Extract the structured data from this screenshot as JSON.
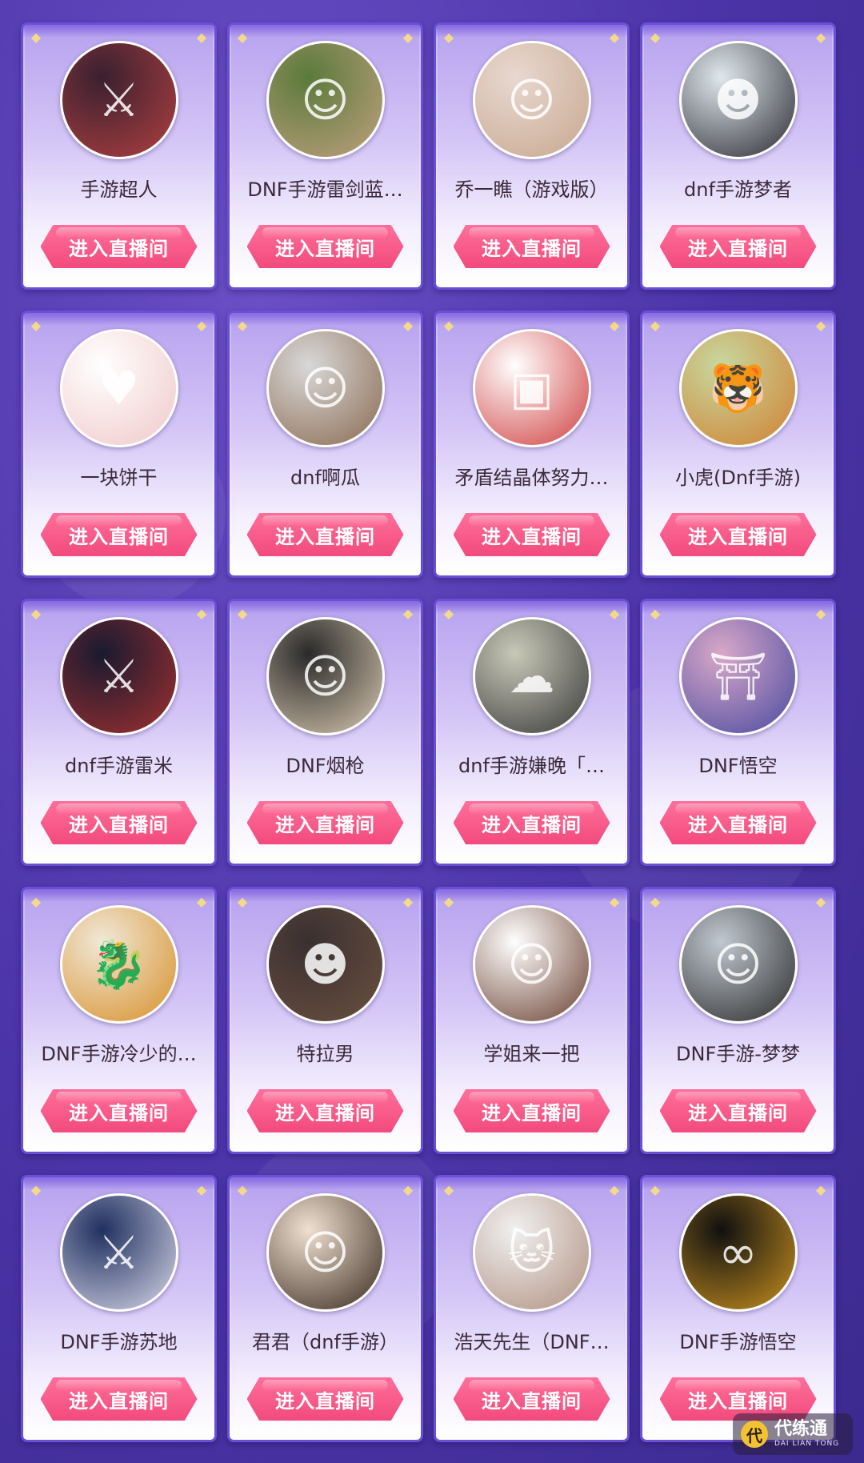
{
  "button_label": "进入直播间",
  "streamers": [
    {
      "name": "手游超人",
      "avatar_icon": "game-character-icon",
      "avatar_colors": [
        "#3a2030",
        "#b04040"
      ],
      "glyph": "⚔"
    },
    {
      "name": "DNF手游雷剑蓝…",
      "avatar_icon": "man-photo-icon",
      "avatar_colors": [
        "#5a7a3a",
        "#c0a080"
      ],
      "glyph": "☺"
    },
    {
      "name": "乔一瞧（游戏版）",
      "avatar_icon": "woman-photo-icon",
      "avatar_colors": [
        "#e8d8d0",
        "#c8a890"
      ],
      "glyph": "☺"
    },
    {
      "name": "dnf手游梦者",
      "avatar_icon": "anime-boy-icon",
      "avatar_colors": [
        "#dfe8ee",
        "#2a2a30"
      ],
      "glyph": "☻"
    },
    {
      "name": "一块饼干",
      "avatar_icon": "cartoon-girl-icon",
      "avatar_colors": [
        "#ffffff",
        "#f0c8c8"
      ],
      "glyph": "♥"
    },
    {
      "name": "dnf啊瓜",
      "avatar_icon": "man-selfie-icon",
      "avatar_colors": [
        "#d8d8d8",
        "#8a6a50"
      ],
      "glyph": "☺"
    },
    {
      "name": "矛盾结晶体努力…",
      "avatar_icon": "pixel-character-icon",
      "avatar_colors": [
        "#ffffff",
        "#d04040"
      ],
      "glyph": "▣"
    },
    {
      "name": "小虎(Dnf手游)",
      "avatar_icon": "tiger-icon",
      "avatar_colors": [
        "#c8d8a0",
        "#d08030"
      ],
      "glyph": "🐯"
    },
    {
      "name": "dnf手游雷米",
      "avatar_icon": "game-character-icon",
      "avatar_colors": [
        "#1a1a30",
        "#a03030"
      ],
      "glyph": "⚔"
    },
    {
      "name": "DNF烟枪",
      "avatar_icon": "man-photo-icon",
      "avatar_colors": [
        "#2a2a2a",
        "#d8c8b0"
      ],
      "glyph": "☺"
    },
    {
      "name": "dnf手游嫌晚「…",
      "avatar_icon": "car-window-icon",
      "avatar_colors": [
        "#c8c8b8",
        "#3a3a3a"
      ],
      "glyph": "☁"
    },
    {
      "name": "DNF悟空",
      "avatar_icon": "game-scene-icon",
      "avatar_colors": [
        "#d8a8c8",
        "#4a4aa0"
      ],
      "glyph": "⛩"
    },
    {
      "name": "DNF手游冷少的…",
      "avatar_icon": "golden-dragon-icon",
      "avatar_colors": [
        "#f0e8d8",
        "#d8902a"
      ],
      "glyph": "🐉"
    },
    {
      "name": "特拉男",
      "avatar_icon": "anime-man-icon",
      "avatar_colors": [
        "#3a3030",
        "#6a5040"
      ],
      "glyph": "☻"
    },
    {
      "name": "学姐来一把",
      "avatar_icon": "anime-girl-icon",
      "avatar_colors": [
        "#ffffff",
        "#6a4030"
      ],
      "glyph": "☺"
    },
    {
      "name": "DNF手游-梦梦",
      "avatar_icon": "woman-photo-icon",
      "avatar_colors": [
        "#c0c8d0",
        "#2a2a2a"
      ],
      "glyph": "☺"
    },
    {
      "name": "DNF手游苏地",
      "avatar_icon": "game-character-icon",
      "avatar_colors": [
        "#203060",
        "#d8d8e8"
      ],
      "glyph": "⚔"
    },
    {
      "name": "君君（dnf手游）",
      "avatar_icon": "anime-girl-icon",
      "avatar_colors": [
        "#f0e0d0",
        "#3a2a20"
      ],
      "glyph": "☺"
    },
    {
      "name": "浩天先生（DNF…",
      "avatar_icon": "cat-icon",
      "avatar_colors": [
        "#f0f0f0",
        "#b09080"
      ],
      "glyph": "🐱"
    },
    {
      "name": "DNF手游悟空",
      "avatar_icon": "gold-spirals-icon",
      "avatar_colors": [
        "#101010",
        "#c89020"
      ],
      "glyph": "∞"
    }
  ],
  "watermark": {
    "main": "代练通",
    "sub": "DAI LIAN TONG",
    "icon_glyph": "代"
  },
  "colors": {
    "button": "#f24a7d",
    "card_border": "#6a4fd8",
    "background": "#4b34a8",
    "corner_gem": "#f3d98a"
  }
}
